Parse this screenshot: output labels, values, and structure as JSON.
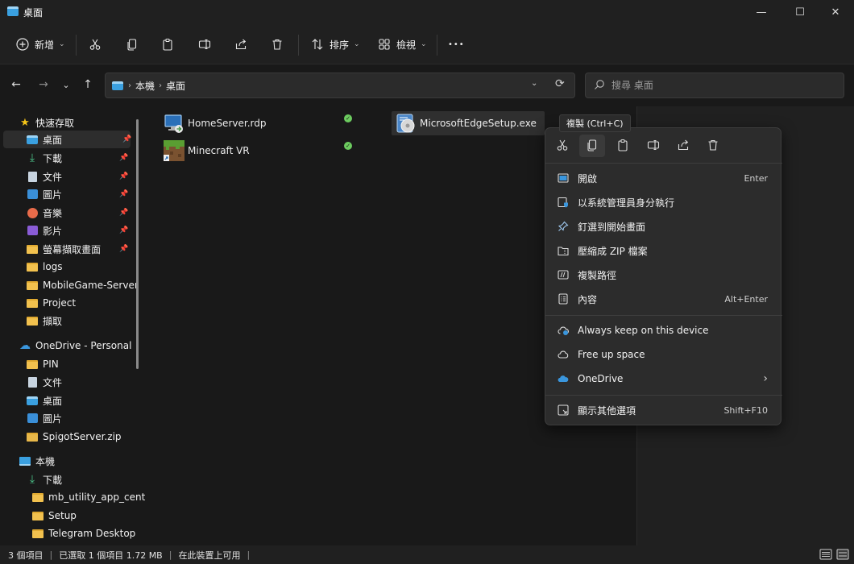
{
  "window": {
    "title": "桌面",
    "minimize": "—",
    "maximize": "☐",
    "close": "✕"
  },
  "toolbar": {
    "new_label": "新增",
    "sort_label": "排序",
    "view_label": "檢視",
    "more": "•••"
  },
  "nav": {
    "crumbs": [
      "本機",
      "桌面"
    ],
    "search_placeholder": "搜尋 桌面"
  },
  "sidebar": {
    "quick_access": "快速存取",
    "quick_items": [
      {
        "label": "桌面",
        "pinned": true,
        "selected": true
      },
      {
        "label": "下載",
        "pinned": true
      },
      {
        "label": "文件",
        "pinned": true
      },
      {
        "label": "圖片",
        "pinned": true
      },
      {
        "label": "音樂",
        "pinned": true
      },
      {
        "label": "影片",
        "pinned": true
      },
      {
        "label": "螢幕擷取畫面",
        "pinned": true
      },
      {
        "label": "logs"
      },
      {
        "label": "MobileGame-Server"
      },
      {
        "label": "Project"
      },
      {
        "label": "擷取"
      }
    ],
    "onedrive": "OneDrive - Personal",
    "onedrive_items": [
      {
        "label": "PIN"
      },
      {
        "label": "文件"
      },
      {
        "label": "桌面"
      },
      {
        "label": "圖片"
      },
      {
        "label": "SpigotServer.zip"
      }
    ],
    "this_pc": "本機",
    "pc_items": [
      {
        "label": "下載"
      },
      {
        "label": "mb_utility_app_center"
      },
      {
        "label": "Setup"
      },
      {
        "label": "Telegram Desktop"
      }
    ]
  },
  "files": [
    {
      "name": "HomeServer.rdp",
      "synced": true
    },
    {
      "name": "Minecraft VR",
      "synced": true
    },
    {
      "name": "MicrosoftEdgeSetup.exe",
      "selected": true
    }
  ],
  "tooltip": "複製 (Ctrl+C)",
  "context_menu": {
    "items_group1": [
      {
        "label": "開啟",
        "shortcut": "Enter",
        "icon": "open-icon"
      },
      {
        "label": "以系統管理員身分執行",
        "shortcut": "",
        "icon": "shield-icon"
      },
      {
        "label": "釘選到開始畫面",
        "shortcut": "",
        "icon": "pin-icon"
      },
      {
        "label": "壓縮成 ZIP 檔案",
        "shortcut": "",
        "icon": "zip-icon"
      },
      {
        "label": "複製路徑",
        "shortcut": "",
        "icon": "copy-path-icon"
      },
      {
        "label": "內容",
        "shortcut": "Alt+Enter",
        "icon": "properties-icon"
      }
    ],
    "items_group2": [
      {
        "label": "Always keep on this device",
        "icon": "cloud-keep-icon"
      },
      {
        "label": "Free up space",
        "icon": "cloud-icon"
      },
      {
        "label": "OneDrive",
        "icon": "onedrive-icon",
        "submenu": "›"
      }
    ],
    "more_options": {
      "label": "顯示其他選項",
      "shortcut": "Shift+F10"
    }
  },
  "status": {
    "item_count": "3 個項目",
    "selected": "已選取 1 個項目 1.72 MB",
    "availability": "在此裝置上可用"
  },
  "colors": {
    "folder": "#f2c14e",
    "accent": "#3aa0e0",
    "sync_green": "#6ccb5f",
    "onedrive_blue": "#3a96dd"
  }
}
